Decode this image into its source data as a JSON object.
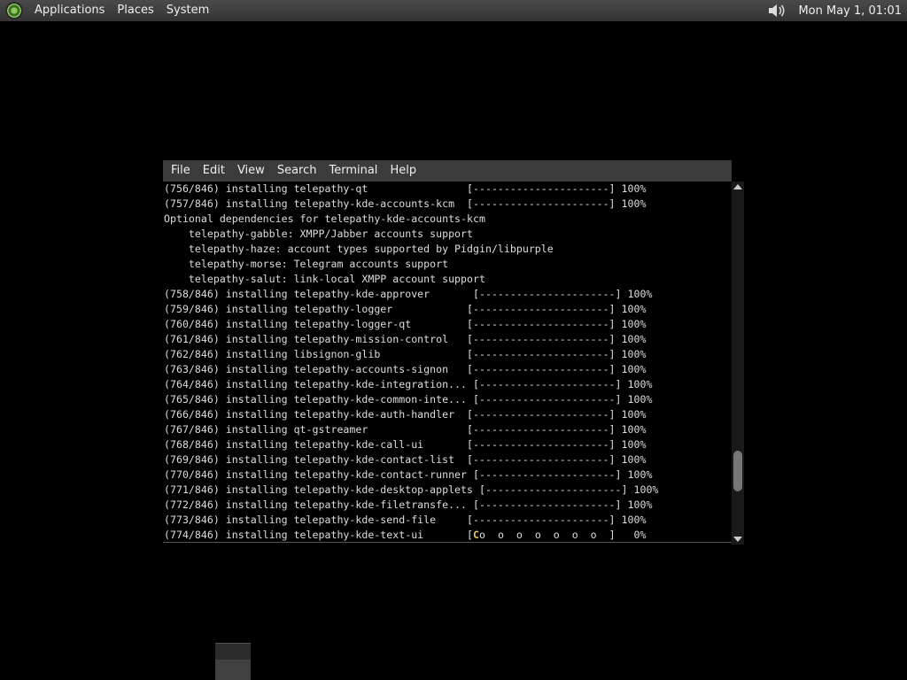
{
  "top_panel": {
    "menus": [
      "Applications",
      "Places",
      "System"
    ],
    "clock": "Mon May  1, 01:01",
    "icons": {
      "menu_logo": "distro-logo-icon",
      "volume": "speaker-icon"
    }
  },
  "terminal": {
    "menus": [
      "File",
      "Edit",
      "View",
      "Search",
      "Terminal",
      "Help"
    ],
    "lines": [
      "(756/846) installing telepathy-qt                [----------------------] 100%",
      "(757/846) installing telepathy-kde-accounts-kcm  [----------------------] 100%",
      "Optional dependencies for telepathy-kde-accounts-kcm",
      "    telepathy-gabble: XMPP/Jabber accounts support",
      "    telepathy-haze: account types supported by Pidgin/libpurple",
      "    telepathy-morse: Telegram accounts support",
      "    telepathy-salut: link-local XMPP account support",
      "(758/846) installing telepathy-kde-approver       [----------------------] 100%",
      "(759/846) installing telepathy-logger            [----------------------] 100%",
      "(760/846) installing telepathy-logger-qt         [----------------------] 100%",
      "(761/846) installing telepathy-mission-control   [----------------------] 100%",
      "(762/846) installing libsignon-glib              [----------------------] 100%",
      "(763/846) installing telepathy-accounts-signon   [----------------------] 100%",
      "(764/846) installing telepathy-kde-integration... [----------------------] 100%",
      "(765/846) installing telepathy-kde-common-inte... [----------------------] 100%",
      "(766/846) installing telepathy-kde-auth-handler  [----------------------] 100%",
      "(767/846) installing qt-gstreamer                [----------------------] 100%",
      "(768/846) installing telepathy-kde-call-ui       [----------------------] 100%",
      "(769/846) installing telepathy-kde-contact-list  [----------------------] 100%",
      "(770/846) installing telepathy-kde-contact-runner [----------------------] 100%",
      "(771/846) installing telepathy-kde-desktop-applets [----------------------] 100%",
      "(772/846) installing telepathy-kde-filetransfe... [----------------------] 100%",
      "(773/846) installing telepathy-kde-send-file     [----------------------] 100%"
    ],
    "last_line_prefix": "(774/846) installing telepathy-kde-text-ui       [",
    "last_line_cursor": "C",
    "last_line_suffix": "o  o  o  o  o  o  o  ]   0%",
    "scroll_position": 0.86
  },
  "colors": {
    "panel_bg": "#3b3b3b",
    "terminal_fg": "#dddddd",
    "progress_cursor": "#e6c84a"
  }
}
